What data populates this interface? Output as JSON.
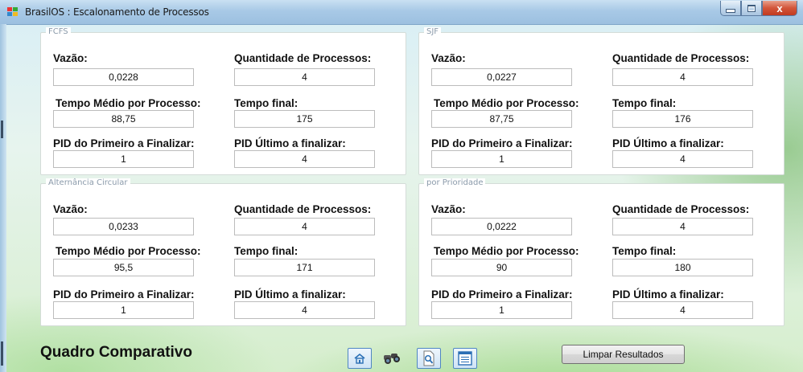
{
  "window": {
    "title": "BrasilOS : Escalonamento de Processos",
    "close_label": "x"
  },
  "labels": {
    "vazao": "Vazão:",
    "quantidade": "Quantidade de Processos:",
    "tempo_medio": "Tempo Médio por Processo:",
    "tempo_final": "Tempo final:",
    "pid_primeiro": "PID do Primeiro a Finalizar:",
    "pid_ultimo": "PID Último a finalizar:"
  },
  "groups": [
    {
      "legend": "FCFS",
      "vazao": "0,0228",
      "quantidade": "4",
      "tempo_medio": "88,75",
      "tempo_final": "175",
      "pid_primeiro": "1",
      "pid_ultimo": "4"
    },
    {
      "legend": "SJF",
      "vazao": "0,0227",
      "quantidade": "4",
      "tempo_medio": "87,75",
      "tempo_final": "176",
      "pid_primeiro": "1",
      "pid_ultimo": "4"
    },
    {
      "legend": "Alternância Circular",
      "vazao": "0,0233",
      "quantidade": "4",
      "tempo_medio": "95,5",
      "tempo_final": "171",
      "pid_primeiro": "1",
      "pid_ultimo": "4"
    },
    {
      "legend": "por Prioridade",
      "vazao": "0,0222",
      "quantidade": "4",
      "tempo_medio": "90",
      "tempo_final": "180",
      "pid_primeiro": "1",
      "pid_ultimo": "4"
    }
  ],
  "footer": {
    "heading": "Quadro Comparativo",
    "clear_button": "Limpar Resultados",
    "toolbar_icons": [
      "home-icon",
      "binoculars-icon",
      "document-search-icon",
      "list-window-icon"
    ]
  },
  "colors": {
    "title_bar": "#a8c9e6",
    "close_button": "#c23a20",
    "panel_bg": "#ffffff",
    "legend_text": "#8a9aaa"
  }
}
